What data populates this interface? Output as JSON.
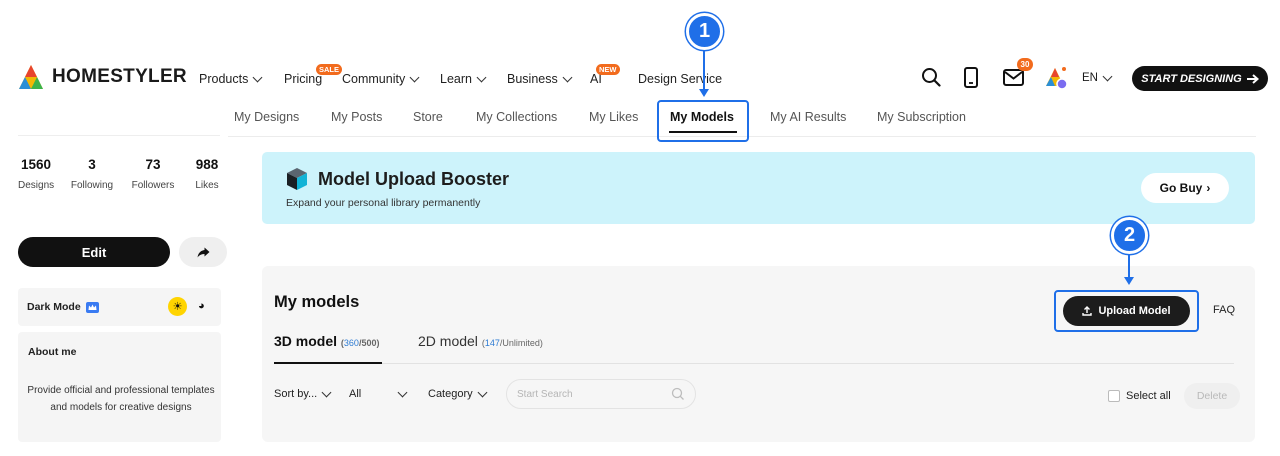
{
  "brand": {
    "name": "HOMESTYLER"
  },
  "topnav": {
    "items": [
      {
        "label": "Products",
        "has_dropdown": true
      },
      {
        "label": "Pricing",
        "badge": "SALE"
      },
      {
        "label": "Community",
        "has_dropdown": true
      },
      {
        "label": "Learn",
        "has_dropdown": true
      },
      {
        "label": "Business",
        "has_dropdown": true
      },
      {
        "label": "AI",
        "badge": "NEW"
      },
      {
        "label": "Design Service"
      }
    ]
  },
  "header": {
    "icons": [
      "search-icon",
      "mobile-icon",
      "mail-icon"
    ],
    "mail_count": "30",
    "language": "EN",
    "cta_label": "START DESIGNING"
  },
  "subtabs": {
    "items": [
      "My Designs",
      "My Posts",
      "Store",
      "My Collections",
      "My Likes",
      "My Models",
      "My AI Results",
      "My Subscription"
    ],
    "active": "My Models"
  },
  "profile": {
    "stats": [
      {
        "value": "1560",
        "label": "Designs"
      },
      {
        "value": "3",
        "label": "Following"
      },
      {
        "value": "73",
        "label": "Followers"
      },
      {
        "value": "988",
        "label": "Likes"
      }
    ],
    "edit_label": "Edit",
    "dark_mode_label": "Dark Mode",
    "about_title": "About me",
    "about_text": "Provide official and professional templates and models for creative designs"
  },
  "booster": {
    "title": "Model Upload Booster",
    "subtitle": "Expand your personal library permanently",
    "button_label": "Go Buy"
  },
  "models": {
    "title": "My models",
    "tabs": [
      {
        "label": "3D model",
        "used": "360",
        "limit": "/500"
      },
      {
        "label": "2D model",
        "used": "147",
        "limit": "/Unlimited"
      }
    ],
    "upload_label": "Upload Model",
    "faq_label": "FAQ",
    "filters": {
      "sort": "Sort by...",
      "all": "All",
      "category": "Category"
    },
    "search_placeholder": "Start Search",
    "select_all_label": "Select all",
    "delete_label": "Delete"
  },
  "annotations": {
    "markers": [
      "1",
      "2"
    ]
  },
  "colors": {
    "accent": "#1f6fe8",
    "badge": "#f26b1d",
    "banner": "#cdf3fb"
  }
}
